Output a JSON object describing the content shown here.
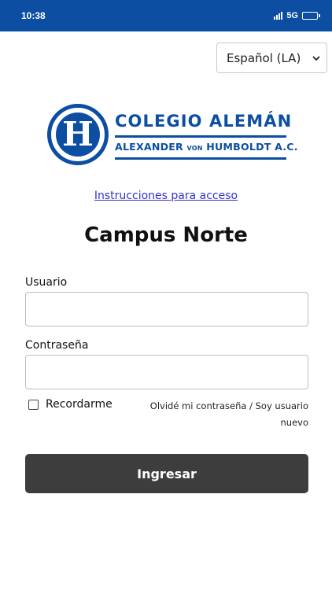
{
  "status_bar": {
    "time": "10:38",
    "network": "5G"
  },
  "language_select": {
    "selected": "Español (LA)",
    "icon": "chevron-down-icon"
  },
  "logo": {
    "mark_letter": "H",
    "line1": "COLEGIO ALEMÁN",
    "line2_a": "ALEXANDER ",
    "line2_von": "VON",
    "line2_b": " HUMBOLDT A.C.",
    "brand_color": "#0b4ea2"
  },
  "instructions_link": "Instrucciones para acceso",
  "campus_title": "Campus Norte",
  "form": {
    "username_label": "Usuario",
    "username_value": "",
    "password_label": "Contraseña",
    "password_value": "",
    "remember_label": "Recordarme",
    "remember_checked": false,
    "forgot_link": "Olvidé mi contraseña / Soy usuario nuevo",
    "submit_label": "Ingresar"
  }
}
